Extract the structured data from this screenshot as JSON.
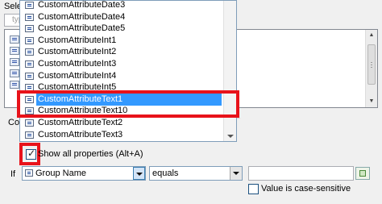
{
  "background": {
    "select_label": "Selec",
    "type_placeholder": "typ",
    "conditions_label": "Con"
  },
  "dropdown": {
    "items": [
      {
        "label": "CustomAttributeDate3",
        "selected": false
      },
      {
        "label": "CustomAttributeDate4",
        "selected": false
      },
      {
        "label": "CustomAttributeDate5",
        "selected": false
      },
      {
        "label": "CustomAttributeInt1",
        "selected": false
      },
      {
        "label": "CustomAttributeInt2",
        "selected": false
      },
      {
        "label": "CustomAttributeInt3",
        "selected": false
      },
      {
        "label": "CustomAttributeInt4",
        "selected": false
      },
      {
        "label": "CustomAttributeInt5",
        "selected": false
      },
      {
        "label": "CustomAttributeText1",
        "selected": true
      },
      {
        "label": "CustomAttributeText10",
        "selected": false
      },
      {
        "label": "CustomAttributeText2",
        "selected": false
      },
      {
        "label": "CustomAttributeText3",
        "selected": false
      }
    ]
  },
  "show_all": {
    "label": "Show all properties (Alt+A)",
    "checked": true
  },
  "condition": {
    "if_label": "If",
    "property_value": "Group Name",
    "operator_value": "equals",
    "value_text": "",
    "case_sensitive_label": "Value is case-sensitive",
    "case_sensitive_checked": false
  },
  "colors": {
    "highlight": "#e8121a",
    "selection": "#3399ff"
  }
}
